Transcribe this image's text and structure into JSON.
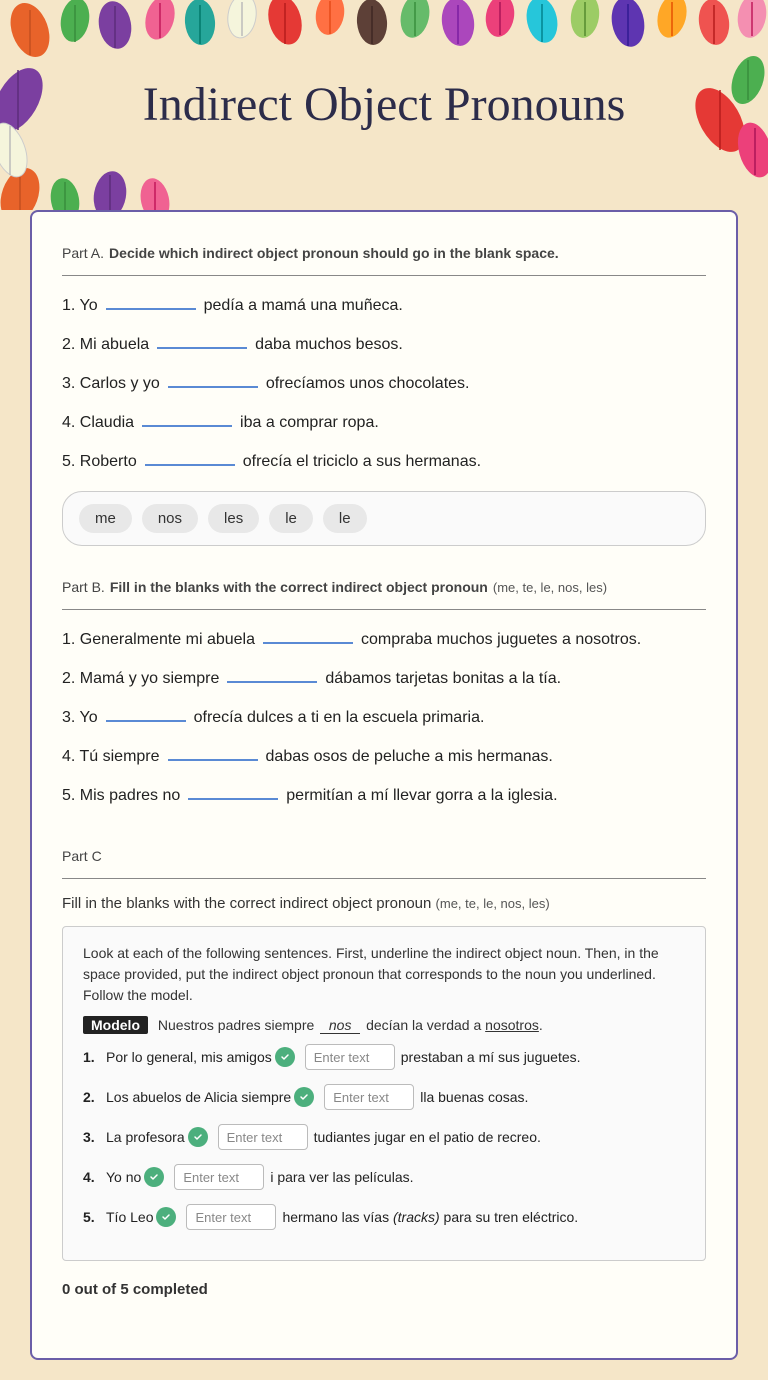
{
  "page": {
    "title": "Indirect Object Pronouns",
    "background_color": "#f5e6c8"
  },
  "partA": {
    "title": "Part A.",
    "instruction": "Decide which indirect object pronoun should go in the blank space.",
    "sentences": [
      {
        "id": "1",
        "prefix": "1. Yo",
        "suffix": "pedía a mamá una muñeca."
      },
      {
        "id": "2",
        "prefix": "2. Mi abuela",
        "suffix": "daba muchos besos."
      },
      {
        "id": "3",
        "prefix": "3. Carlos y yo",
        "suffix": "ofrecíamos unos chocolates."
      },
      {
        "id": "4",
        "prefix": "4. Claudia",
        "suffix": "iba a comprar ropa."
      },
      {
        "id": "5",
        "prefix": "5. Roberto",
        "suffix": "ofrecía el triciclo a sus hermanas."
      }
    ],
    "word_bank": [
      "me",
      "nos",
      "les",
      "le",
      "le"
    ]
  },
  "partB": {
    "title": "Part B.",
    "instruction": "Fill in the blanks with the correct indirect object pronoun",
    "hint": "(me, te, le, nos, les)",
    "sentences": [
      {
        "id": "1",
        "text": "1. Generalmente mi abuela",
        "blank": true,
        "suffix": "compraba muchos juguetes a nosotros."
      },
      {
        "id": "2",
        "text": "2. Mamá y yo siempre",
        "blank": true,
        "suffix": "dábamos tarjetas bonitas a la tía."
      },
      {
        "id": "3",
        "text": "3. Yo",
        "blank": true,
        "suffix": "ofrecía dulces a ti en la escuela primaria."
      },
      {
        "id": "4",
        "text": "4. Tú siempre",
        "blank": true,
        "suffix": "dabas osos de peluche a mis hermanas."
      },
      {
        "id": "5",
        "text": "5. Mis padres no",
        "blank": true,
        "suffix": "permitían a mí llevar gorra a la iglesia."
      }
    ]
  },
  "partC": {
    "title": "Part C",
    "instruction": "Fill in the blanks with the correct indirect object pronoun",
    "hint": "(me, te, le, nos, les)",
    "box_instructions": "Look at each of the following sentences. First, underline the indirect object noun. Then, in the space provided, put the indirect object pronoun that corresponds to the noun you underlined. Follow the model.",
    "modelo_label": "Modelo",
    "modelo_text": "Nuestros padres siempre",
    "modelo_blank": "nos",
    "modelo_suffix": "decían la verdad a",
    "modelo_underlined": "nosotros",
    "sentences": [
      {
        "id": "1",
        "prefix": "Por lo general, mis amigos",
        "enter_text": "Enter text",
        "suffix": "prestaban a mí sus juguetes."
      },
      {
        "id": "2",
        "prefix": "Los abuelos de Alicia siempre",
        "enter_text": "Enter text",
        "suffix": "lla buenas cosas."
      },
      {
        "id": "3",
        "prefix": "La profesora",
        "enter_text": "Enter text",
        "suffix": "tudiantes jugar en el patio de recreo."
      },
      {
        "id": "4",
        "prefix": "Yo no",
        "enter_text": "Enter text",
        "suffix": "i para ver las películas."
      },
      {
        "id": "5",
        "prefix": "Tío Leo",
        "enter_text": "Enter text",
        "suffix": "hermano las vías (tracks) para su tren eléctrico."
      }
    ],
    "progress": "0 out of 5 completed"
  }
}
